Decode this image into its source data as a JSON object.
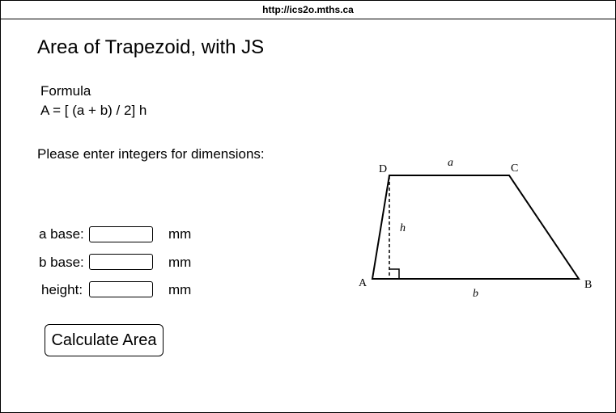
{
  "browser": {
    "url": "http://ics2o.mths.ca"
  },
  "page": {
    "title": "Area of Trapezoid, with JS",
    "formula_label": "Formula",
    "formula": "A = [ (a + b) / 2] h",
    "instructions": "Please enter integers for dimensions:"
  },
  "form": {
    "a_base": {
      "label": "a base:",
      "unit": "mm",
      "value": ""
    },
    "b_base": {
      "label": "b base:",
      "unit": "mm",
      "value": ""
    },
    "height": {
      "label": "height:",
      "unit": "mm",
      "value": ""
    },
    "button_label": "Calculate Area"
  },
  "diagram": {
    "vertex_a": "A",
    "vertex_b": "B",
    "vertex_c": "C",
    "vertex_d": "D",
    "side_a": "a",
    "side_b": "b",
    "height": "h"
  }
}
